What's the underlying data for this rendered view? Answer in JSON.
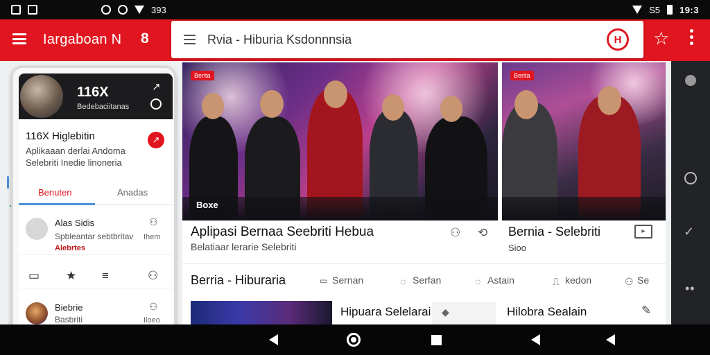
{
  "status_bar": {
    "left_text": "393",
    "right_text": "S5",
    "time": "19:3"
  },
  "app_bar": {
    "title": "Iargaboan N",
    "badge": "8",
    "search_text": "Rvia - Hiburia Ksdonnnsia",
    "logo_text": "H",
    "accent_color": "#e0151f"
  },
  "phone_card": {
    "count": "116X",
    "count_sub": "Bedebaciitanas",
    "title": "116X Higlebitin",
    "desc_line1": "Aplikaaan derlai Andoma",
    "desc_line2": "Selebriti Inedie linoneria",
    "tabs": [
      "Benuten",
      "Anadas"
    ],
    "item1": {
      "name": "Alas Sidis",
      "sub": "Spbleantar sebtbritav",
      "tag": "Alebrtes",
      "right": "Ihem"
    },
    "item2": {
      "name": "Biebrie",
      "sub": "Basbriti",
      "right": "Iloeo"
    }
  },
  "cards": [
    {
      "tag": "Berita",
      "caption": "Boxe",
      "title": "Aplipasi Bernaa Seebriti Hebua",
      "sub": "Belatiaar lerarie Selebriti"
    },
    {
      "tag": "Berita",
      "title": "Bernia - Selebriti",
      "sub": "Sioo"
    }
  ],
  "section": {
    "title": "Berria - Hiburaria",
    "tabs": [
      "Sernan",
      "Serfan",
      "Astain",
      "kedon",
      "Se"
    ]
  },
  "list_row": {
    "title": "Hipuara Selelarai",
    "title2": "Hilobra Sealain"
  },
  "icons": {
    "menu": "hamburger-icon",
    "star": "star-icon",
    "more": "more-vert-icon",
    "user": "user-icon",
    "share": "share-icon",
    "edit": "edit-icon"
  }
}
